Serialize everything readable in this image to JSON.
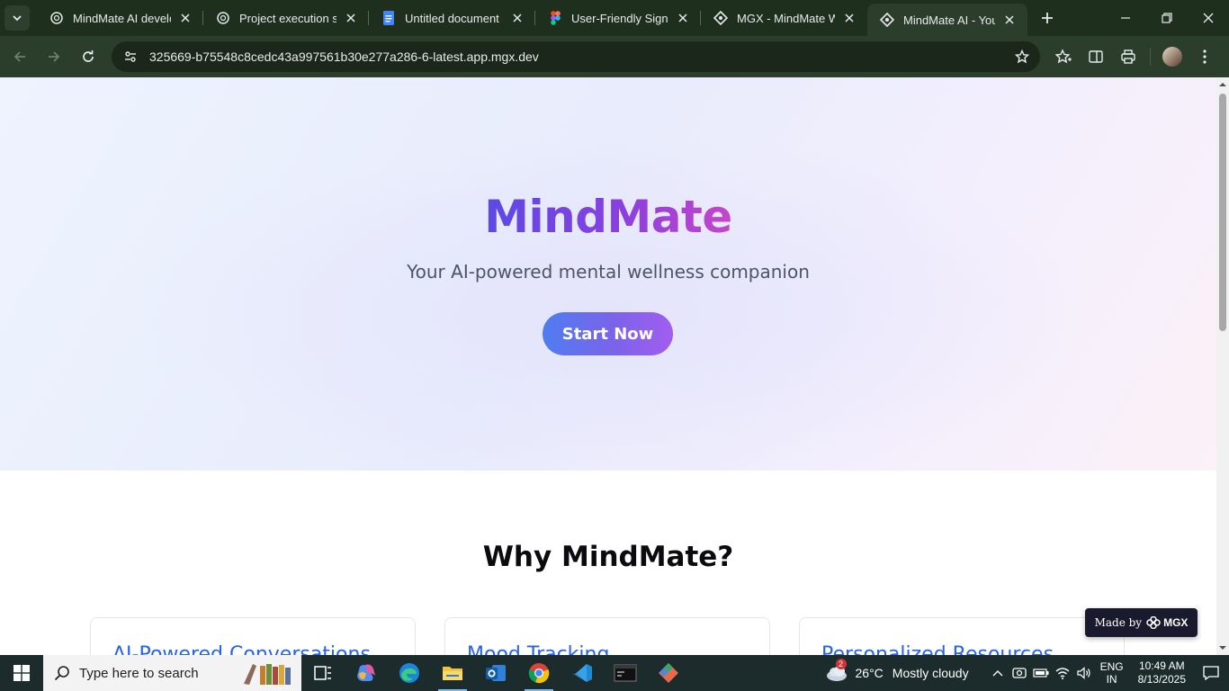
{
  "browser": {
    "tabs": [
      {
        "title": "MindMate AI develop",
        "icon": "openai-icon",
        "active": false
      },
      {
        "title": "Project execution sup",
        "icon": "openai-icon",
        "active": false
      },
      {
        "title": "Untitled document - ",
        "icon": "google-docs-icon",
        "active": false
      },
      {
        "title": "User-Friendly Sign-Up",
        "icon": "figma-icon",
        "active": false
      },
      {
        "title": "MGX - MindMate Wi",
        "icon": "mgx-icon",
        "active": false
      },
      {
        "title": "MindMate AI - Your M",
        "icon": "mgx-icon",
        "active": true
      }
    ],
    "url": "325669-b75548c8cedc43a997561b30e277a286-6-latest.app.mgx.dev"
  },
  "hero": {
    "brand": "MindMate",
    "tagline": "Your AI-powered mental wellness companion",
    "cta_label": "Start Now"
  },
  "features": {
    "title": "Why MindMate?",
    "cards": [
      {
        "title": "AI-Powered Conversations"
      },
      {
        "title": "Mood Tracking"
      },
      {
        "title": "Personalized Resources"
      }
    ]
  },
  "made_by": {
    "text": "Made by",
    "logo": "MGX"
  },
  "taskbar": {
    "search_placeholder": "Type here to search",
    "weather": {
      "temp": "26°C",
      "condition": "Mostly cloudy",
      "badge": "2"
    },
    "lang": {
      "line1": "ENG",
      "line2": "IN"
    },
    "clock": {
      "time": "10:49 AM",
      "date": "8/13/2025"
    }
  },
  "colors": {
    "brand_gradient_start": "#5b4ae6",
    "brand_gradient_end": "#c646c8",
    "cta_gradient_start": "#4f7df0",
    "cta_gradient_end": "#a35df0",
    "card_title": "#2563eb"
  }
}
